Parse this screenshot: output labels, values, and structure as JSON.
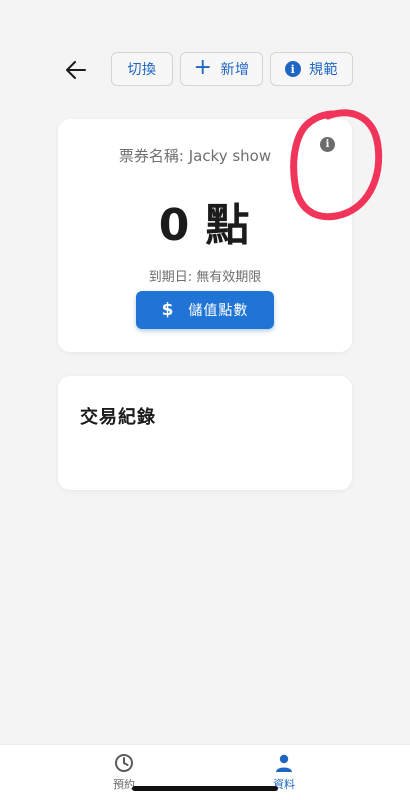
{
  "toolbar": {
    "back_icon": "arrow-left-icon",
    "switch_label": "切換",
    "add_label": "新增",
    "add_icon": "plus-icon",
    "rules_label": "規範",
    "rules_icon": "info-icon"
  },
  "ticket": {
    "name_text": "票券名稱: Jacky show",
    "points_value": "0",
    "points_unit": "點",
    "expiry_text": "到期日: 無有效期限",
    "topup_label": "儲值點數",
    "topup_icon": "dollar-icon",
    "info_icon": "info-icon"
  },
  "transactions": {
    "title": "交易紀錄"
  },
  "bottom_nav": {
    "items": [
      {
        "label": "預約",
        "icon": "clock-icon",
        "active": false
      },
      {
        "label": "資料",
        "icon": "person-icon",
        "active": true
      }
    ]
  },
  "colors": {
    "accent": "#1f66c2",
    "button": "#1f74d6",
    "annotation": "#f0345a",
    "background": "#f4f4f5"
  }
}
